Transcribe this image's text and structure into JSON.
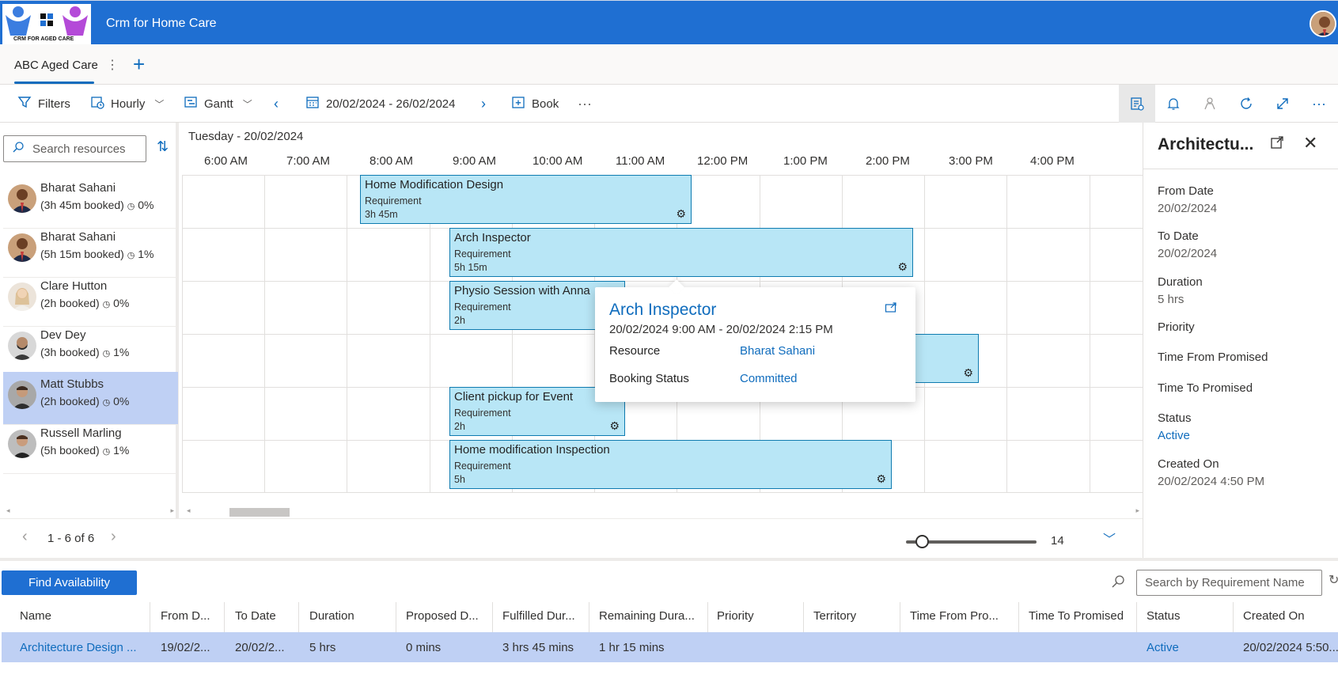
{
  "app": {
    "title": "Crm for Home Care",
    "logo_text": "CRM FOR AGED CARE"
  },
  "tabs": {
    "active": "ABC Aged Care"
  },
  "toolbar": {
    "filters": "Filters",
    "view_mode": "Hourly",
    "layout": "Gantt",
    "date_range": "20/02/2024 - 26/02/2024",
    "book": "Book"
  },
  "resources": {
    "search_placeholder": "Search resources",
    "items": [
      {
        "name": "Bharat Sahani",
        "booked": "(3h 45m booked)",
        "util": "0%"
      },
      {
        "name": "Bharat Sahani",
        "booked": "(5h 15m booked)",
        "util": "1%"
      },
      {
        "name": "Clare Hutton",
        "booked": "(2h booked)",
        "util": "0%"
      },
      {
        "name": "Dev Dey",
        "booked": "(3h booked)",
        "util": "1%"
      },
      {
        "name": "Matt Stubbs",
        "booked": "(2h booked)",
        "util": "0%"
      },
      {
        "name": "Russell Marling",
        "booked": "(5h booked)",
        "util": "1%"
      }
    ],
    "pager": "1 - 6 of 6"
  },
  "gantt": {
    "day_label": "Tuesday - 20/02/2024",
    "hours": [
      "6:00 AM",
      "7:00 AM",
      "8:00 AM",
      "9:00 AM",
      "10:00 AM",
      "11:00 AM",
      "12:00 PM",
      "1:00 PM",
      "2:00 PM",
      "3:00 PM",
      "4:00 PM"
    ],
    "bookings": [
      {
        "title": "Home Modification Design",
        "type": "Requirement",
        "duration": "3h 45m"
      },
      {
        "title": "Arch Inspector",
        "type": "Requirement",
        "duration": "5h 15m"
      },
      {
        "title": "Physio Session with Anna",
        "type": "Requirement",
        "duration": "2h"
      },
      {
        "title": "Client pickup for Event",
        "type": "Requirement",
        "duration": "2h"
      },
      {
        "title": "Home modification Inspection",
        "type": "Requirement",
        "duration": "5h"
      }
    ],
    "zoom_value": "14"
  },
  "popup": {
    "title": "Arch Inspector",
    "time_range": "20/02/2024 9:00 AM - 20/02/2024 2:15 PM",
    "resource_label": "Resource",
    "resource_value": "Bharat Sahani",
    "status_label": "Booking Status",
    "status_value": "Committed"
  },
  "details": {
    "title": "Architectu...",
    "fields": [
      {
        "label": "From Date",
        "value": "20/02/2024"
      },
      {
        "label": "To Date",
        "value": "20/02/2024"
      },
      {
        "label": "Duration",
        "value": "5 hrs"
      },
      {
        "label": "Priority",
        "value": ""
      },
      {
        "label": "Time From Promised",
        "value": ""
      },
      {
        "label": "Time To Promised",
        "value": ""
      },
      {
        "label": "Status",
        "value": "Active"
      },
      {
        "label": "Created On",
        "value": "20/02/2024 4:50 PM"
      }
    ]
  },
  "requirements": {
    "find_button": "Find Availability",
    "search_placeholder": "Search by Requirement Name",
    "columns": [
      "Name",
      "From D...",
      "To Date",
      "Duration",
      "Proposed D...",
      "Fulfilled Dur...",
      "Remaining Dura...",
      "Priority",
      "Territory",
      "Time From Pro...",
      "Time To Promised",
      "Status",
      "Created On"
    ],
    "row": [
      "Architecture Design ...",
      "19/02/2...",
      "20/02/2...",
      "5 hrs",
      "0 mins",
      "3 hrs 45 mins",
      "1 hr 15 mins",
      "",
      "",
      "",
      "",
      "Active",
      "20/02/2024 5:50..."
    ]
  },
  "colors": {
    "brand": "#1f6fd2",
    "booking_fill": "#b8e6f6",
    "selected_row": "#bfd0f4",
    "link": "#0f6cbd"
  }
}
